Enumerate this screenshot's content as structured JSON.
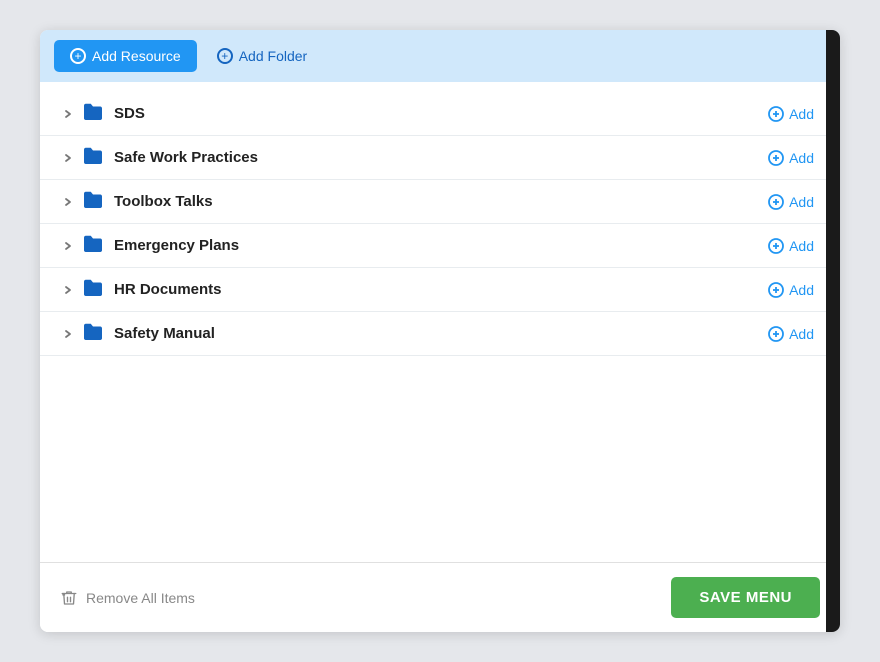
{
  "toolbar": {
    "add_resource_label": "Add Resource",
    "add_folder_label": "Add Folder"
  },
  "folders": [
    {
      "id": 1,
      "name": "SDS",
      "add_label": "Add"
    },
    {
      "id": 2,
      "name": "Safe Work Practices",
      "add_label": "Add"
    },
    {
      "id": 3,
      "name": "Toolbox Talks",
      "add_label": "Add"
    },
    {
      "id": 4,
      "name": "Emergency Plans",
      "add_label": "Add"
    },
    {
      "id": 5,
      "name": "HR Documents",
      "add_label": "Add"
    },
    {
      "id": 6,
      "name": "Safety Manual",
      "add_label": "Add"
    }
  ],
  "footer": {
    "remove_all_label": "Remove All Items",
    "save_menu_label": "SAVE MENU"
  }
}
